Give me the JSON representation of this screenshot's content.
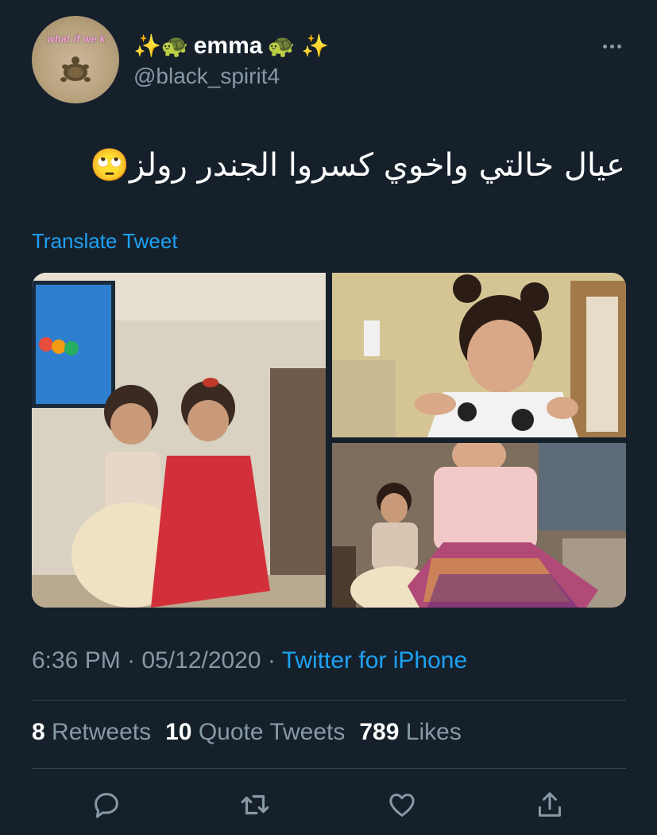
{
  "user": {
    "display_name_emoji_left": "✨🐢",
    "display_name": "emma",
    "display_name_emoji_right": "🐢 ✨",
    "handle": "@black_spirit4",
    "avatar_text": "what if we k",
    "avatar_icon": "turtle-icon"
  },
  "tweet": {
    "text": "عيال خالتي واخوي كسروا الجندر رولز🙄",
    "translate_label": "Translate Tweet"
  },
  "media": {
    "count": 3,
    "photos": [
      "photo-two-girls-dresses",
      "photo-child-hair-buns",
      "photo-girls-dancing"
    ]
  },
  "meta": {
    "time": "6:36 PM",
    "separator": " · ",
    "date": "05/12/2020",
    "source": "Twitter for iPhone"
  },
  "stats": {
    "retweets_count": "8",
    "retweets_label": "Retweets",
    "quotes_count": "10",
    "quotes_label": "Quote Tweets",
    "likes_count": "789",
    "likes_label": "Likes"
  },
  "actions": [
    "reply-icon",
    "retweet-icon",
    "like-icon",
    "share-icon"
  ],
  "colors": {
    "background": "#15202b",
    "accent": "#1da1f2",
    "secondary_text": "#8899a6",
    "divider": "#38444d"
  }
}
